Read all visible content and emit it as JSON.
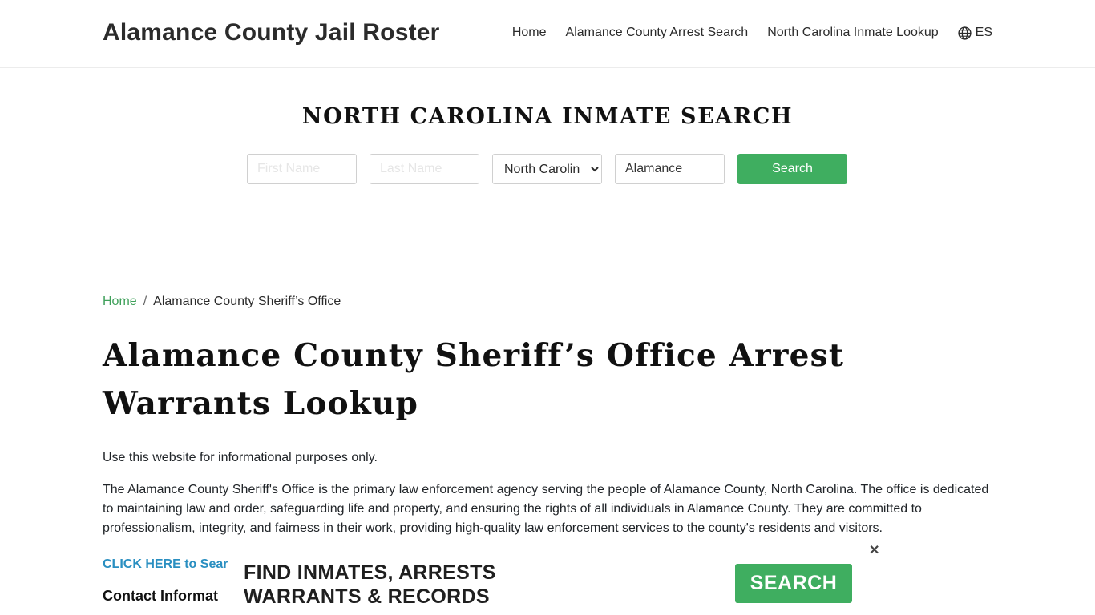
{
  "header": {
    "brand": "Alamance County Jail Roster",
    "nav": [
      {
        "label": "Home"
      },
      {
        "label": "Alamance County Arrest Search"
      },
      {
        "label": "North Carolina Inmate Lookup"
      }
    ],
    "language": {
      "label": "ES",
      "icon": "globe-icon"
    }
  },
  "search": {
    "title": "NORTH CAROLINA INMATE SEARCH",
    "first_name_placeholder": "First Name",
    "last_name_placeholder": "Last Name",
    "state_selected": "North Carolina",
    "county_value": "Alamance",
    "button_label": "Search"
  },
  "breadcrumb": {
    "home": "Home",
    "separator": "/",
    "current": "Alamance County Sheriff’s Office"
  },
  "page": {
    "title": "Alamance County Sheriff’s Office Arrest Warrants Lookup",
    "disclaimer": "Use this website for informational purposes only.",
    "intro": "The Alamance County Sheriff's Office is the primary law enforcement agency serving the people of Alamance County, North Carolina. The office is dedicated to maintaining law and order, safeguarding life and property, and ensuring the rights of all individuals in Alamance County. They are committed to professionalism, integrity, and fairness in their work, providing high-quality law enforcement services to the county's residents and visitors.",
    "click_link": "CLICK HERE to Sear",
    "contact_heading": "Contact Informat"
  },
  "ad": {
    "line1": "FIND INMATES, ARRESTS",
    "line2": "WARRANTS & RECORDS",
    "button_label": "SEARCH",
    "close_symbol": "✕"
  },
  "colors": {
    "accent_green": "#3fae60",
    "link_blue": "#2a8fc1"
  }
}
